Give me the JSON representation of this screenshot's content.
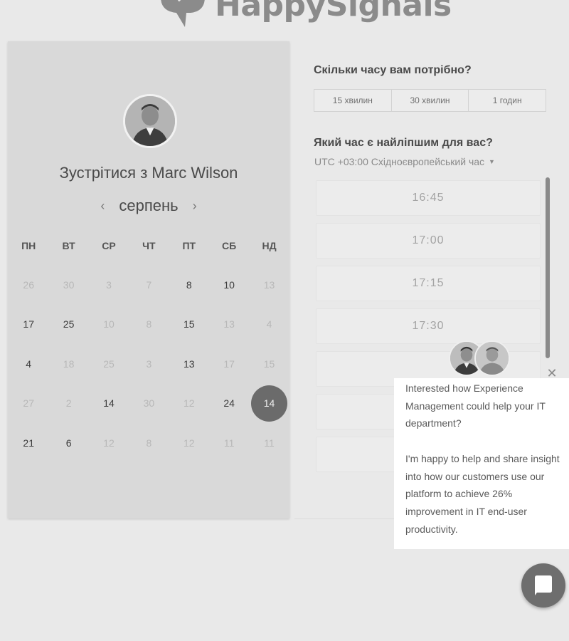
{
  "logo": {
    "text": "HappySignals"
  },
  "calendar": {
    "title": "Зустрітися з Marc Wilson",
    "month": "серпень",
    "prev_icon": "‹",
    "next_icon": "›",
    "weekdays": [
      "ПН",
      "ВТ",
      "СР",
      "ЧТ",
      "ПТ",
      "СБ",
      "НД"
    ],
    "days": [
      {
        "label": "26",
        "state": "dim"
      },
      {
        "label": "30",
        "state": "dim"
      },
      {
        "label": "3",
        "state": "dim"
      },
      {
        "label": "7",
        "state": "dim"
      },
      {
        "label": "8",
        "state": "active"
      },
      {
        "label": "10",
        "state": "active"
      },
      {
        "label": "13",
        "state": "dim"
      },
      {
        "label": "17",
        "state": "active"
      },
      {
        "label": "25",
        "state": "active"
      },
      {
        "label": "10",
        "state": "dim"
      },
      {
        "label": "8",
        "state": "dim"
      },
      {
        "label": "15",
        "state": "active"
      },
      {
        "label": "13",
        "state": "dim"
      },
      {
        "label": "4",
        "state": "dim"
      },
      {
        "label": "4",
        "state": "active"
      },
      {
        "label": "18",
        "state": "dim"
      },
      {
        "label": "25",
        "state": "dim"
      },
      {
        "label": "3",
        "state": "dim"
      },
      {
        "label": "13",
        "state": "active"
      },
      {
        "label": "17",
        "state": "dim"
      },
      {
        "label": "15",
        "state": "dim"
      },
      {
        "label": "27",
        "state": "dim"
      },
      {
        "label": "2",
        "state": "dim"
      },
      {
        "label": "14",
        "state": "active"
      },
      {
        "label": "30",
        "state": "dim"
      },
      {
        "label": "12",
        "state": "dim"
      },
      {
        "label": "24",
        "state": "active"
      },
      {
        "label": "14",
        "state": "selected"
      },
      {
        "label": "21",
        "state": "active"
      },
      {
        "label": "6",
        "state": "active"
      },
      {
        "label": "12",
        "state": "dim"
      },
      {
        "label": "8",
        "state": "dim"
      },
      {
        "label": "12",
        "state": "dim"
      },
      {
        "label": "11",
        "state": "dim"
      },
      {
        "label": "11",
        "state": "dim"
      }
    ]
  },
  "duration": {
    "question": "Скільки часу вам потрібно?",
    "options": [
      "15 хвилин",
      "30 хвилин",
      "1 годин"
    ]
  },
  "time": {
    "question": "Який час є найліпшим для вас?",
    "timezone": "UTC +03:00 Східноєвропейський час",
    "slots": [
      "16:45",
      "17:00",
      "17:15",
      "17:30",
      "",
      "",
      ""
    ]
  },
  "chat": {
    "close_icon": "✕",
    "message_1": "Interested how Experience Management could help your IT department?",
    "message_2": "I'm happy to help and share insight into how our customers use our platform to achieve 26% improvement in IT end-user productivity."
  },
  "colors": {
    "background": "#e9e9e9",
    "panel": "#d9d9d9",
    "selected_day": "#6b6b6b",
    "logo": "#8b8b8b"
  }
}
